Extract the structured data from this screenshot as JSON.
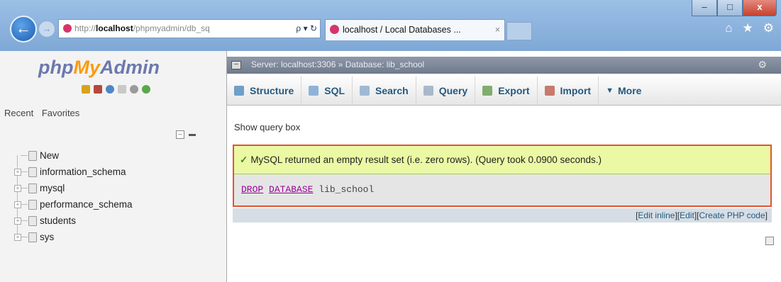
{
  "browser": {
    "address_prefix": "http://",
    "address_host": "localhost",
    "address_rest": "/phpmyadmin/db_sq",
    "address_tools": "ρ ▾ ↻",
    "tab_title": "localhost / Local Databases ...",
    "tab_close": "×",
    "back_glyph": "←",
    "forward_glyph": "→",
    "icons": [
      "home-icon",
      "star-icon",
      "gear-icon"
    ]
  },
  "window_controls": {
    "minimize": "–",
    "maximize": "□",
    "close": "x"
  },
  "sidebar": {
    "logo_php": "php",
    "logo_my": "My",
    "logo_admin": "Admin",
    "tabs": [
      "Recent",
      "Favorites"
    ],
    "tree": [
      {
        "label": "New"
      },
      {
        "label": "information_schema"
      },
      {
        "label": "mysql"
      },
      {
        "label": "performance_schema"
      },
      {
        "label": "students"
      },
      {
        "label": "sys"
      }
    ]
  },
  "main": {
    "breadcrumb": "Server: localhost:3306 » Database: lib_school",
    "toolbar": [
      {
        "label": "Structure",
        "icon": "structure-icon",
        "color": "#6f9fc8"
      },
      {
        "label": "SQL",
        "icon": "sql-icon",
        "color": "#8fb3d8"
      },
      {
        "label": "Search",
        "icon": "search-icon",
        "color": "#9fb9d4"
      },
      {
        "label": "Query",
        "icon": "query-icon",
        "color": "#a8b9c9"
      },
      {
        "label": "Export",
        "icon": "export-icon",
        "color": "#7fae6e"
      },
      {
        "label": "Import",
        "icon": "import-icon",
        "color": "#c77a6e"
      },
      {
        "label": "More",
        "icon": "chevron-down-icon",
        "color": "#235a81"
      }
    ],
    "show_query_box": "Show query box",
    "success_message": "MySQL returned an empty result set (i.e. zero rows). (Query took 0.0900 seconds.)",
    "sql": {
      "kw1": "DROP",
      "kw2": "DATABASE",
      "ident": "lib_school"
    },
    "links": {
      "edit_inline": "Edit inline",
      "edit": "Edit",
      "create_php": "Create PHP code"
    }
  }
}
